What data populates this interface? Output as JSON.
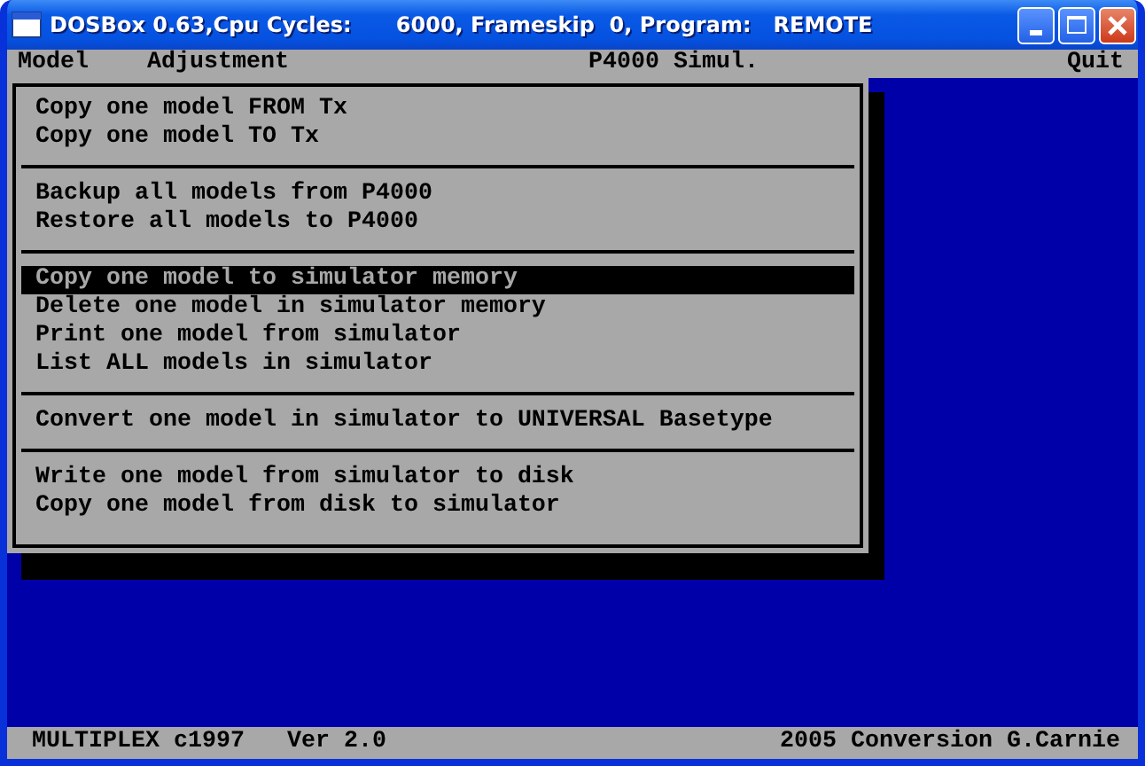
{
  "window": {
    "title": "DOSBox 0.63,Cpu Cycles:      6000, Frameskip  0, Program:   REMOTE"
  },
  "menu_bar": [
    {
      "label": "Model"
    },
    {
      "label": "Adjustment"
    },
    {
      "label": "P4000 Simul."
    },
    {
      "label": "Quit"
    }
  ],
  "menu_groups": [
    {
      "items": [
        {
          "label": "Copy one model FROM Tx",
          "selected": false
        },
        {
          "label": "Copy one model TO Tx",
          "selected": false
        }
      ]
    },
    {
      "items": [
        {
          "label": "Backup all models from P4000",
          "selected": false
        },
        {
          "label": "Restore all models to P4000",
          "selected": false
        }
      ]
    },
    {
      "items": [
        {
          "label": "Copy one model to simulator memory",
          "selected": true
        },
        {
          "label": "Delete one model in simulator memory",
          "selected": false
        },
        {
          "label": "Print one model from simulator",
          "selected": false
        },
        {
          "label": "List ALL models in simulator",
          "selected": false
        }
      ]
    },
    {
      "items": [
        {
          "label": "Convert one model in simulator to UNIVERSAL Basetype",
          "selected": false
        }
      ]
    },
    {
      "items": [
        {
          "label": "Write one model from simulator to disk",
          "selected": false
        },
        {
          "label": "Copy one model from disk to simulator",
          "selected": false
        }
      ]
    }
  ],
  "status_bar": {
    "left": "MULTIPLEX c1997   Ver 2.0",
    "right": "2005 Conversion G.Carnie"
  }
}
